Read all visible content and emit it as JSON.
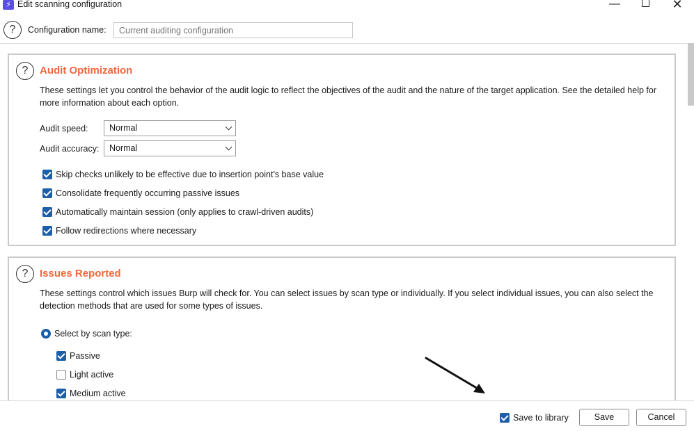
{
  "window": {
    "title": "Edit scanning configuration",
    "minimize": "—",
    "close": "✕"
  },
  "config": {
    "name_label": "Configuration name:",
    "name_placeholder": "Current auditing configuration"
  },
  "help_glyph": "?",
  "audit": {
    "title": "Audit Optimization",
    "description": "These settings let you control the behavior of the audit logic to reflect the objectives of the audit and the nature of the target application. See the detailed help for more information about each option.",
    "speed_label": "Audit speed:",
    "speed_value": "Normal",
    "accuracy_label": "Audit accuracy:",
    "accuracy_value": "Normal",
    "options": [
      {
        "label": "Skip checks unlikely to be effective due to insertion point's base value",
        "checked": true
      },
      {
        "label": "Consolidate frequently occurring passive issues",
        "checked": true
      },
      {
        "label": "Automatically maintain session (only applies to crawl-driven audits)",
        "checked": true
      },
      {
        "label": "Follow redirections where necessary",
        "checked": true
      }
    ]
  },
  "issues": {
    "title": "Issues Reported",
    "description": "These settings control which issues Burp will check for. You can select issues by scan type or individually. If you select individual issues, you can also select the detection methods that are used for some types of issues.",
    "select_by_scan_type": "Select by scan type:",
    "scan_types": [
      {
        "label": "Passive",
        "checked": true
      },
      {
        "label": "Light active",
        "checked": false
      },
      {
        "label": "Medium active",
        "checked": true
      }
    ]
  },
  "footer": {
    "save_to_library": "Save to library",
    "save_to_library_checked": true,
    "save": "Save",
    "cancel": "Cancel"
  }
}
